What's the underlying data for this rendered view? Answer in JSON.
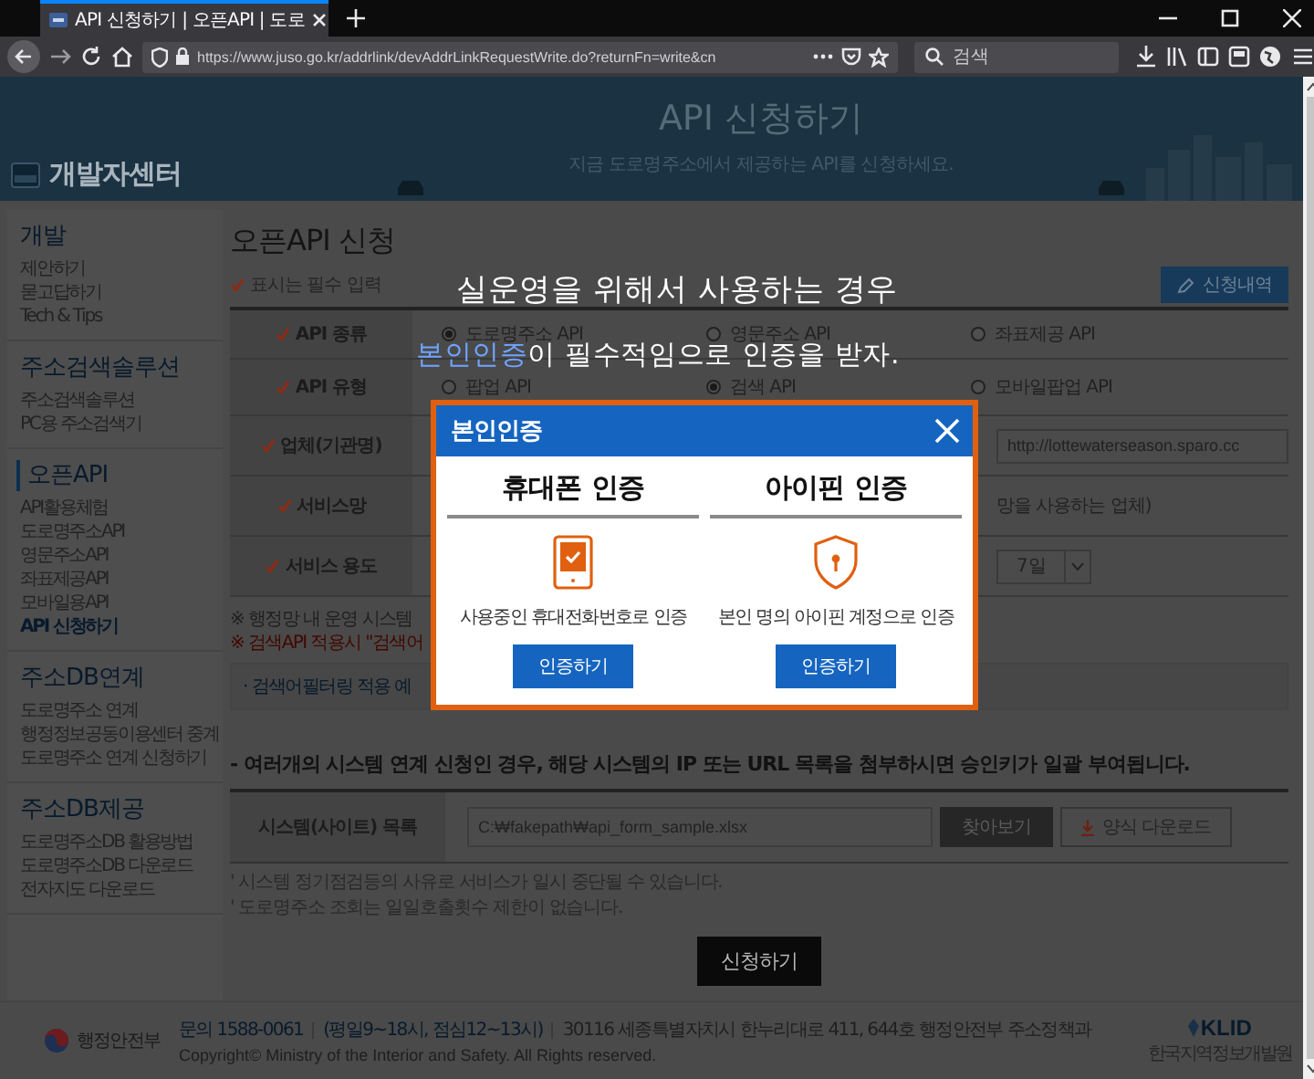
{
  "browser": {
    "tab_title": "API 신청하기 | 오픈API | 도로",
    "address": "https://www.juso.go.kr/addrlink/devAddrLinkRequestWrite.do?returnFn=write&cn",
    "search_placeholder": "검색"
  },
  "header": {
    "logo_text": "개발자센터",
    "title": "API 신청하기",
    "subtitle": "지금 도로명주소에서 제공하는 API를 신청하세요."
  },
  "sidebar": {
    "sections": [
      {
        "title": "개발",
        "selected": false,
        "items": [
          {
            "label": "제안하기",
            "selected": false
          },
          {
            "label": "묻고답하기",
            "selected": false
          },
          {
            "label": "Tech & Tips",
            "selected": false
          }
        ]
      },
      {
        "title": "주소검색솔루션",
        "selected": false,
        "items": [
          {
            "label": "주소검색솔루션",
            "selected": false
          },
          {
            "label": "PC용 주소검색기",
            "selected": false
          }
        ]
      },
      {
        "title": "오픈API",
        "selected": true,
        "items": [
          {
            "label": "API활용체험",
            "selected": false
          },
          {
            "label": "도로명주소API",
            "selected": false
          },
          {
            "label": "영문주소API",
            "selected": false
          },
          {
            "label": "좌표제공API",
            "selected": false
          },
          {
            "label": "모바일용API",
            "selected": false
          },
          {
            "label": "API 신청하기",
            "selected": true
          }
        ]
      },
      {
        "title": "주소DB연계",
        "selected": false,
        "items": [
          {
            "label": "도로명주소 연계",
            "selected": false
          },
          {
            "label": "행정정보공동이용센터 중계",
            "selected": false
          },
          {
            "label": "도로명주소 연계 신청하기",
            "selected": false
          }
        ]
      },
      {
        "title": "주소DB제공",
        "selected": false,
        "items": [
          {
            "label": "도로명주소DB 활용방법",
            "selected": false
          },
          {
            "label": "도로명주소DB 다운로드",
            "selected": false
          },
          {
            "label": "전자지도 다운로드",
            "selected": false
          }
        ]
      }
    ]
  },
  "main": {
    "title": "오픈API 신청",
    "required_note": "표시는 필수 입력",
    "history_button": "신청내역",
    "form_rows": [
      {
        "label": "API 종류",
        "kind": "radios",
        "options": [
          {
            "label": "도로명주소 API",
            "selected": true
          },
          {
            "label": "영문주소 API",
            "selected": false
          },
          {
            "label": "좌표제공 API",
            "selected": false
          }
        ]
      },
      {
        "label": "API 유형",
        "kind": "radios",
        "options": [
          {
            "label": "팝업 API",
            "selected": false
          },
          {
            "label": "검색 API",
            "selected": true
          },
          {
            "label": "모바일팝업 API",
            "selected": false
          }
        ]
      },
      {
        "label": "업체(기관명)",
        "kind": "input",
        "value": "http://lottewaterseason.sparo.cc"
      },
      {
        "label": "서비스망",
        "kind": "text",
        "text": "망을 사용하는 업체)"
      },
      {
        "label": "서비스 용도",
        "kind": "select",
        "value": "7일"
      }
    ],
    "notes": [
      {
        "kind": "plain",
        "text": "※ 행정망 내 운영 시스템"
      },
      {
        "kind": "warning",
        "text": "※ 검색API 적용시 \"검색어"
      }
    ],
    "filter_note": "· 검색어필터링 적용 예",
    "multi_system_note": "- 여러개의 시스템 연계 신청인 경우, 해당 시스템의 IP 또는 URL 목록을 첨부하시면 승인키가 일괄 부여됩니다.",
    "file_row": {
      "label": "시스템(사이트) 목록",
      "value": "C:₩fakepath₩api_form_sample.xlsx",
      "browse_button": "찾아보기",
      "download_button": "양식 다운로드"
    },
    "footnotes": [
      "' 시스템 정기점검등의 사유로 서비스가 일시 중단될 수 있습니다.",
      "' 도로명주소 조회는 일일호출횟수 제한이 없습니다."
    ],
    "submit_button": "신청하기"
  },
  "annotation": {
    "lines": [
      {
        "parts": [
          {
            "text": "실운영을 위해서 사용하는 경우",
            "highlight": false
          }
        ]
      },
      {
        "parts": [
          {
            "text": "본인인증",
            "highlight": true
          },
          {
            "text": "이 필수적임으로 인증을 받자.",
            "highlight": false
          }
        ]
      }
    ]
  },
  "modal": {
    "title": "본인인증",
    "options": [
      {
        "kind": "phone",
        "heading": "휴대폰 인증",
        "description": "사용중인 휴대전화번호로 인증",
        "button": "인증하기"
      },
      {
        "kind": "ipin",
        "heading": "아이핀 인증",
        "description": "본인 명의 아이핀 계정으로 인증",
        "button": "인증하기"
      }
    ]
  },
  "footer": {
    "ministry": "행정안전부",
    "contact": "문의 1588-0061",
    "hours": "(평일9~18시, 점심12~13시)",
    "address": "30116 세종특별자치시 한누리대로 411, 644호 행정안전부 주소정책과",
    "copyright": "Copyright© Ministry of the Interior and Safety. All Rights reserved.",
    "partner_logo": "KLID",
    "partner_name": "한국지역정보개발원"
  }
}
